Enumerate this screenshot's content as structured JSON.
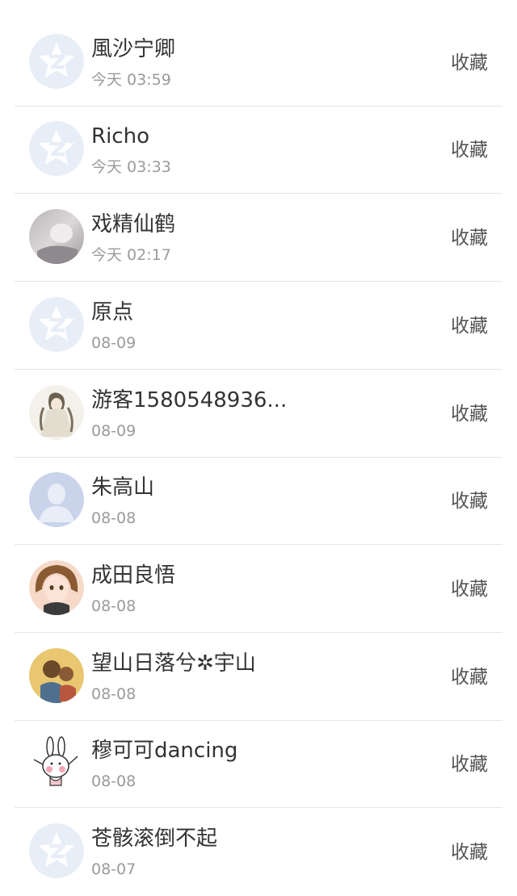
{
  "items": [
    {
      "name": "風沙宁卿",
      "time": "今天 03:59",
      "action": "收藏",
      "avatar": "default-qzone-avatar"
    },
    {
      "name": "Richo",
      "time": "今天 03:33",
      "action": "收藏",
      "avatar": "default-qzone-avatar"
    },
    {
      "name": "戏精仙鹤",
      "time": "今天 02:17",
      "action": "收藏",
      "avatar": "gray-photo-avatar"
    },
    {
      "name": "原点",
      "time": "08-09",
      "action": "收藏",
      "avatar": "default-qzone-avatar"
    },
    {
      "name": "游客1580548936...",
      "time": "08-09",
      "action": "收藏",
      "avatar": "illustrated-figure-avatar"
    },
    {
      "name": "朱高山",
      "time": "08-08",
      "action": "收藏",
      "avatar": "default-person-avatar"
    },
    {
      "name": "成田良悟",
      "time": "08-08",
      "action": "收藏",
      "avatar": "anime-girl-avatar"
    },
    {
      "name": "望山日落兮✲宇山",
      "time": "08-08",
      "action": "收藏",
      "avatar": "cartoon-kids-avatar"
    },
    {
      "name": "穆可可dancing",
      "time": "08-08",
      "action": "收藏",
      "avatar": "rabbit-avatar"
    },
    {
      "name": "苍骸滚倒不起",
      "time": "08-07",
      "action": "收藏",
      "avatar": "default-qzone-avatar"
    }
  ]
}
